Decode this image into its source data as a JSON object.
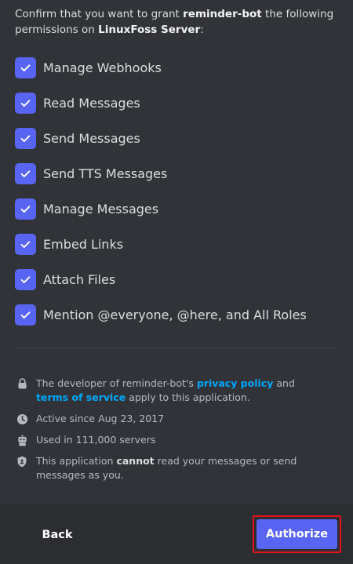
{
  "intro": {
    "prefix": "Confirm that you want to grant ",
    "bot_name": "reminder-bot",
    "middle": " the following permissions on ",
    "server_name": "LinuxFoss Server",
    "suffix": ":"
  },
  "permissions": [
    {
      "label": "Manage Webhooks",
      "checked": true
    },
    {
      "label": "Read Messages",
      "checked": true
    },
    {
      "label": "Send Messages",
      "checked": true
    },
    {
      "label": "Send TTS Messages",
      "checked": true
    },
    {
      "label": "Manage Messages",
      "checked": true
    },
    {
      "label": "Embed Links",
      "checked": true
    },
    {
      "label": "Attach Files",
      "checked": true
    },
    {
      "label": "Mention @everyone, @here, and All Roles",
      "checked": true
    }
  ],
  "info": {
    "policy": {
      "prefix": "The developer of reminder-bot's ",
      "privacy_link": "privacy policy",
      "and": " and ",
      "terms_link": "terms of service",
      "suffix": " apply to this application."
    },
    "active_since": "Active since Aug 23, 2017",
    "servers": "Used in 111,000 servers",
    "cannot": {
      "prefix": "This application ",
      "bold": "cannot",
      "suffix": " read your messages or send messages as you."
    }
  },
  "footer": {
    "back_label": "Back",
    "authorize_label": "Authorize"
  },
  "colors": {
    "accent": "#5865f2",
    "link": "#00a8fc",
    "highlight_border": "#e5101b"
  }
}
